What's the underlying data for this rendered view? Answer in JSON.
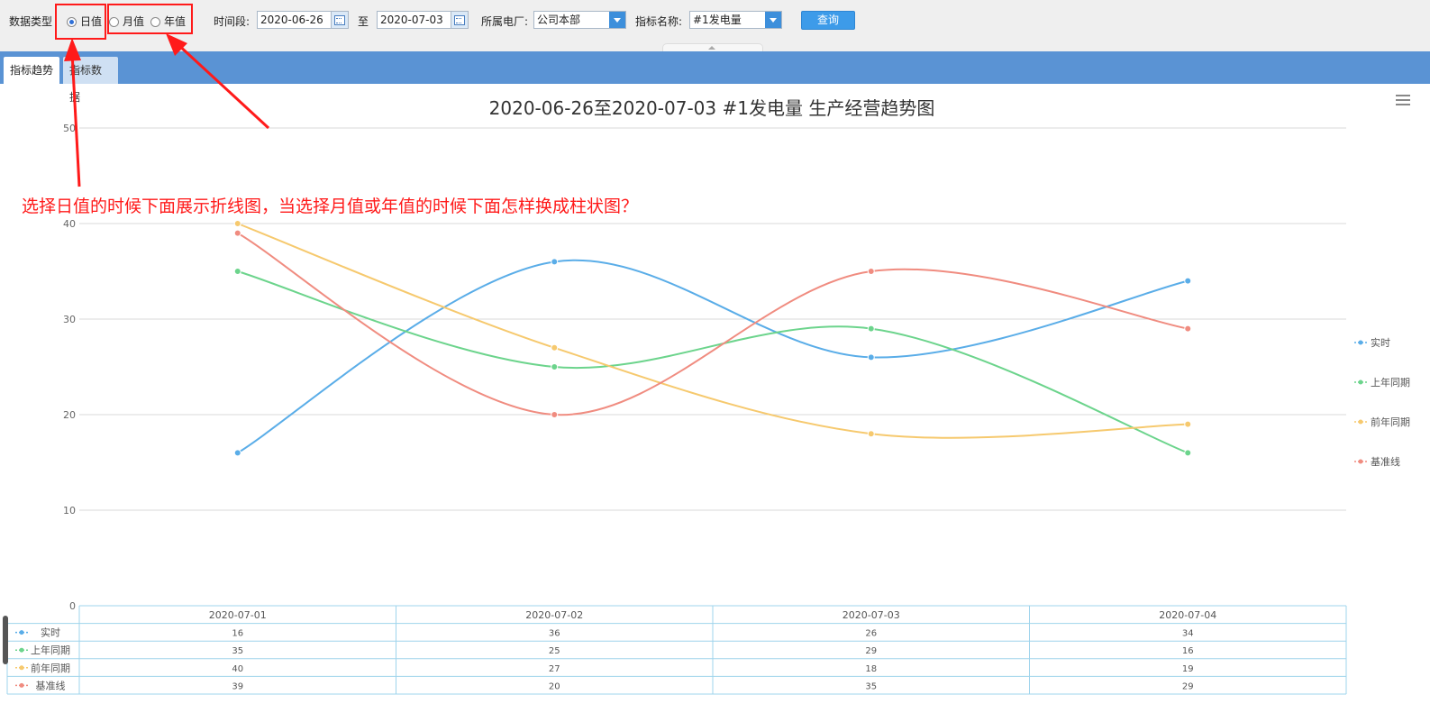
{
  "toolbar": {
    "data_type_label": "数据类型",
    "radios": [
      {
        "label": "日值",
        "checked": true
      },
      {
        "label": "月值",
        "checked": false
      },
      {
        "label": "年值",
        "checked": false
      }
    ],
    "period_label": "时间段:",
    "date_from": "2020-06-26",
    "to_label": "至",
    "date_to": "2020-07-03",
    "plant_label": "所属电厂:",
    "plant_value": "公司本部",
    "indicator_label": "指标名称:",
    "indicator_value": "#1发电量",
    "query_label": "查询"
  },
  "tabs": [
    {
      "label": "指标趋势",
      "active": true
    },
    {
      "label": "指标数据",
      "active": false
    }
  ],
  "annotation": {
    "text": "选择日值的时候下面展示折线图，当选择月值或年值的时候下面怎样换成柱状图？",
    "color": "#ff1a1a"
  },
  "chart_data": {
    "type": "line",
    "title": "2020-06-26至2020-07-03 #1发电量 生产经营趋势图",
    "categories": [
      "2020-07-01",
      "2020-07-02",
      "2020-07-03",
      "2020-07-04"
    ],
    "ylim": [
      0,
      50
    ],
    "yticks": [
      0,
      10,
      20,
      30,
      40,
      50
    ],
    "grid": true,
    "legend_position": "right",
    "series": [
      {
        "name": "实时",
        "color": "#5aade8",
        "values": [
          16,
          36,
          26,
          34
        ]
      },
      {
        "name": "上年同期",
        "color": "#6cd48c",
        "values": [
          35,
          25,
          29,
          16
        ]
      },
      {
        "name": "前年同期",
        "color": "#f6c96e",
        "values": [
          40,
          27,
          18,
          19
        ]
      },
      {
        "name": "基准线",
        "color": "#f08c80",
        "values": [
          39,
          20,
          35,
          29
        ]
      }
    ]
  }
}
